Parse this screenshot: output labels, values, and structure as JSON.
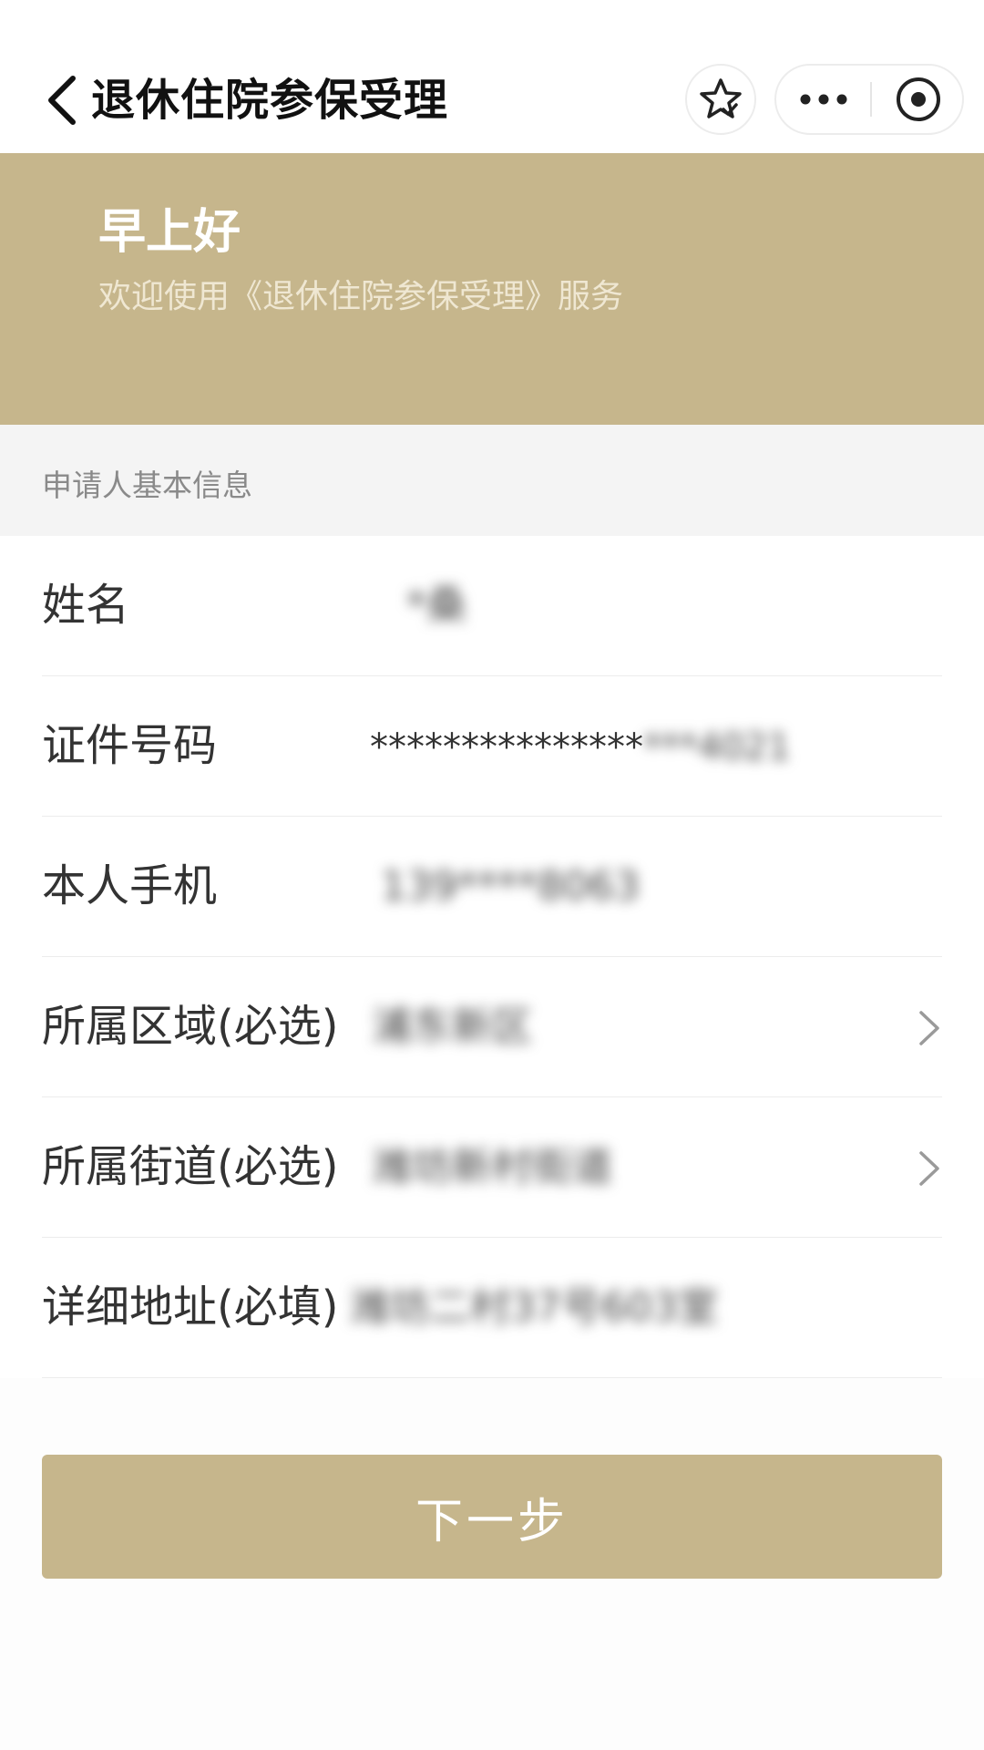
{
  "navbar": {
    "title": "退休住院参保受理",
    "back_icon": "chevron-left-icon",
    "favorite_icon": "star-icon",
    "more_icon": "more-dots-icon",
    "close_icon": "target-circle-icon"
  },
  "banner": {
    "greeting": "早上好",
    "welcome": "欢迎使用《退休住院参保受理》服务",
    "background_color": "#c6b68c"
  },
  "section": {
    "title": "申请人基本信息"
  },
  "form": {
    "rows": [
      {
        "label": "姓名",
        "value": "*桑",
        "blurred": true,
        "has_arrow": false
      },
      {
        "label": "证件号码",
        "value": "****************4021",
        "blurred_suffix": true,
        "has_arrow": false
      },
      {
        "label": "本人手机",
        "value": "139****8063",
        "blurred": true,
        "has_arrow": false
      },
      {
        "label": "所属区域(必选)",
        "value": "浦东新区",
        "blurred": true,
        "has_arrow": true
      },
      {
        "label": "所属街道(必选)",
        "value": "潍坊新村街道",
        "blurred": true,
        "has_arrow": true
      },
      {
        "label": "详细地址(必填)",
        "value": "潍坊二村37号603室",
        "blurred": true,
        "has_arrow": false
      }
    ],
    "id_prefix": "***************",
    "id_suffix": "***4021"
  },
  "actions": {
    "next_label": "下一步",
    "accent_color": "#c6b68c"
  }
}
